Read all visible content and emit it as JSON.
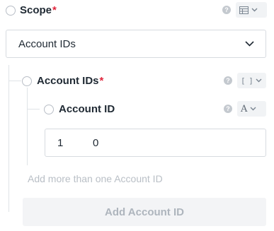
{
  "scope": {
    "label": "Scope",
    "required_mark": "*",
    "help_icon": "question-icon",
    "type_icon": "table-icon",
    "selected_value": "Account IDs"
  },
  "account_ids": {
    "label": "Account IDs",
    "required_mark": "*",
    "help_icon": "question-icon",
    "type_icon": "array-brackets-icon",
    "type_glyph": "[ ]"
  },
  "account_id": {
    "label": "Account ID",
    "help_icon": "question-icon",
    "type_icon": "text-type-icon",
    "type_glyph": "A",
    "value": "1          0"
  },
  "helper_text": "Add more than one Account ID",
  "add_button_label": "Add Account ID",
  "colors": {
    "required": "#e0253c",
    "border": "#d7dbe0",
    "muted_text": "#b9bfc6"
  }
}
